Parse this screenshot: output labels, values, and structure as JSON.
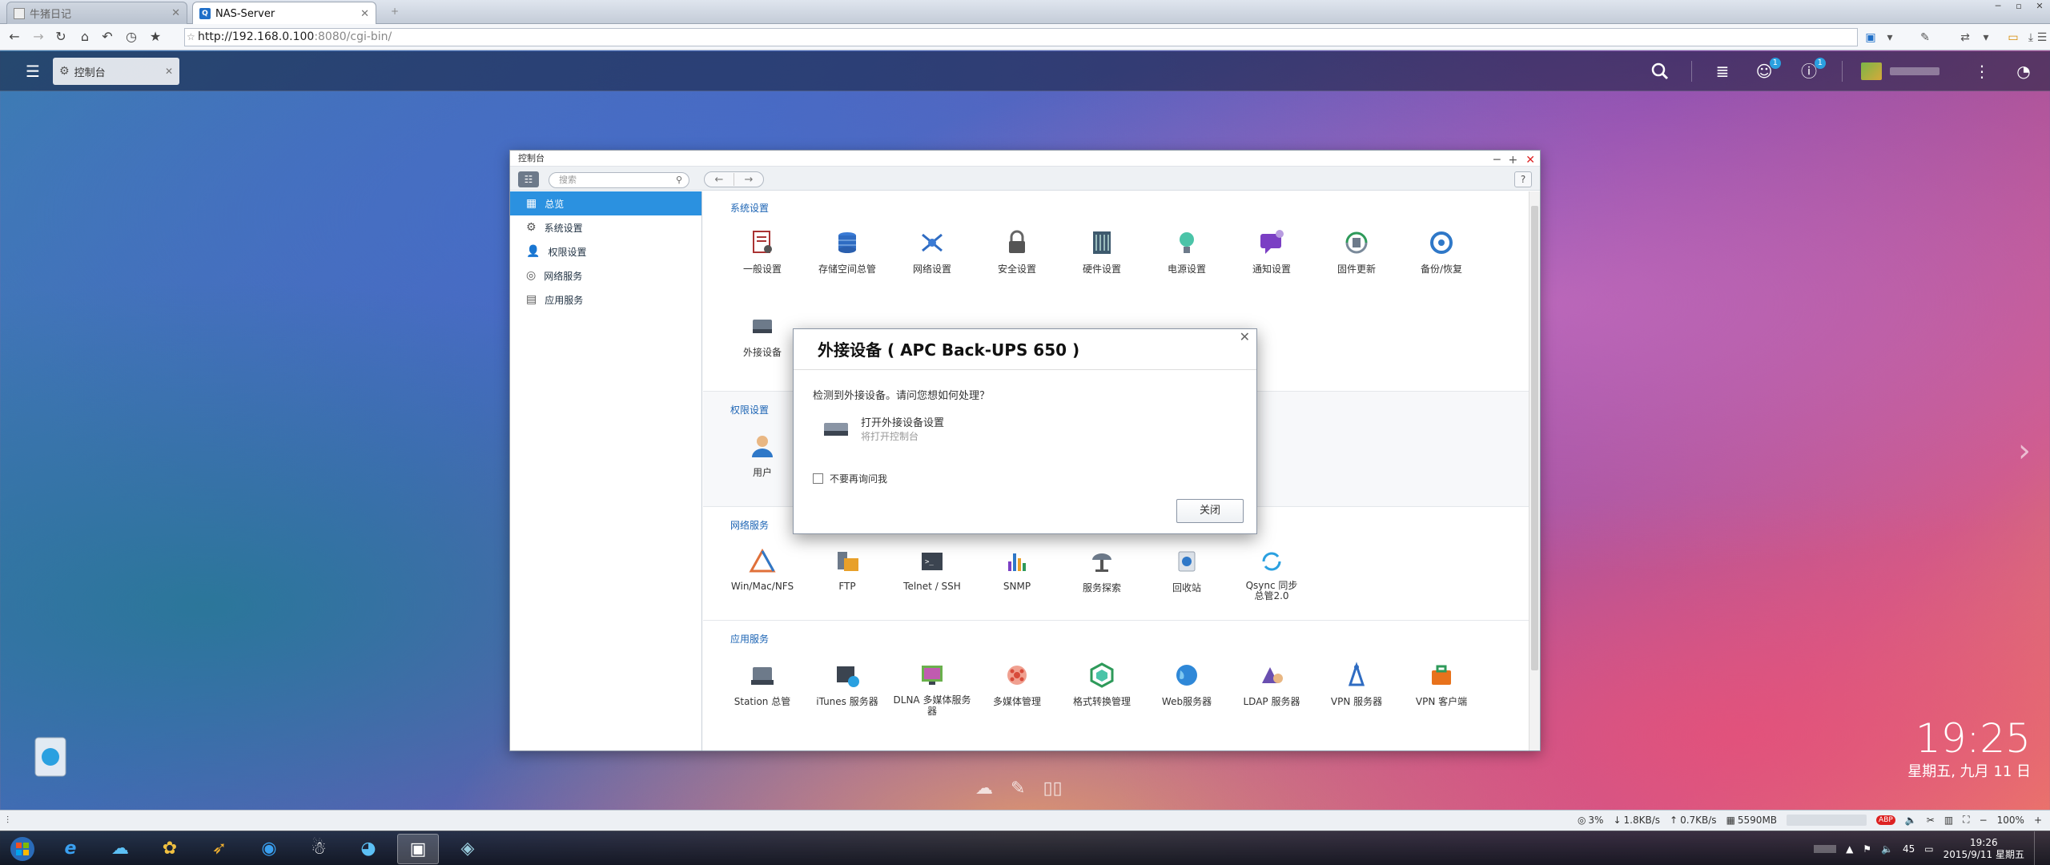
{
  "browser": {
    "tabs": [
      {
        "label": "牛猪日记",
        "active": false
      },
      {
        "label": "NAS-Server",
        "active": true
      }
    ],
    "url_host": "http://192.168.0.100",
    "url_path": ":8080/cgi-bin/"
  },
  "qnap": {
    "app_tab": "控制台",
    "notif_badge": "1",
    "info_badge": "1"
  },
  "window": {
    "title": "控制台",
    "search_placeholder": "搜索",
    "help": "?",
    "sidebar": [
      {
        "label": "总览",
        "icon": "grid-icon",
        "selected": true
      },
      {
        "label": "系统设置",
        "icon": "gear-icon",
        "selected": false
      },
      {
        "label": "权限设置",
        "icon": "user-icon",
        "selected": false
      },
      {
        "label": "网络服务",
        "icon": "globe-icon",
        "selected": false
      },
      {
        "label": "应用服务",
        "icon": "server-icon",
        "selected": false
      }
    ],
    "sections": {
      "system": {
        "title": "系统设置",
        "items": [
          "一般设置",
          "存储空间总管",
          "网络设置",
          "安全设置",
          "硬件设置",
          "电源设置",
          "通知设置",
          "固件更新",
          "备份/恢复",
          "外接设备"
        ]
      },
      "privilege": {
        "title": "权限设置",
        "items": [
          "用户"
        ]
      },
      "network": {
        "title": "网络服务",
        "items": [
          "Win/Mac/NFS",
          "FTP",
          "Telnet / SSH",
          "SNMP",
          "服务探索",
          "回收站",
          "Qsync 同步\n总管2.0"
        ]
      },
      "apps": {
        "title": "应用服务",
        "items": [
          "Station 总管",
          "iTunes 服务器",
          "DLNA 多媒体服务器",
          "多媒体管理",
          "格式转换管理",
          "Web服务器",
          "LDAP 服务器",
          "VPN 服务器",
          "VPN 客户端"
        ]
      }
    }
  },
  "modal": {
    "title": "外接设备 ( APC Back-UPS 650 )",
    "question": "检测到外接设备。请问您想如何处理？",
    "option_title": "打开外接设备设置",
    "option_sub": "将打开控制台",
    "checkbox_label": "不要再询问我",
    "close_label": "关闭"
  },
  "desktop": {
    "time": "19:25",
    "date": "星期五, 九月 11 日"
  },
  "statusbar": {
    "cpu": "3%",
    "down": "1.8KB/s",
    "up": "0.7KB/s",
    "mem": "5590MB",
    "zoom": "100%",
    "adblock": "ABP"
  },
  "taskbar": {
    "time": "19:26",
    "date": "2015/9/11 星期五",
    "lang": "45"
  }
}
